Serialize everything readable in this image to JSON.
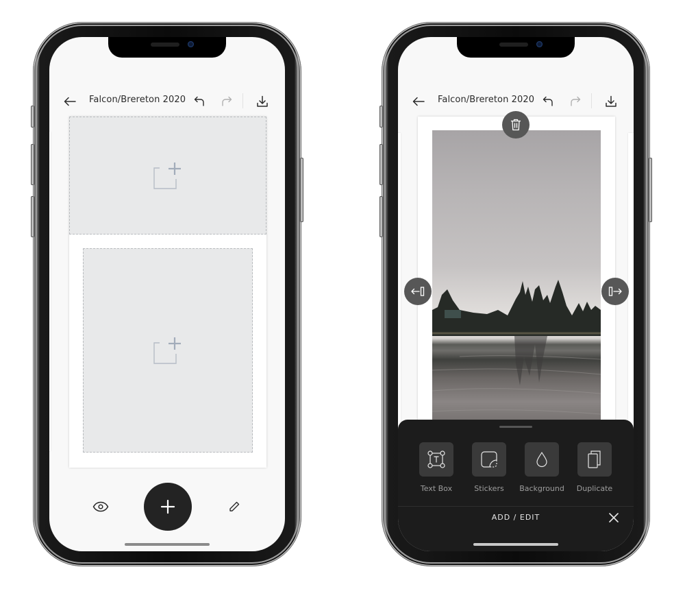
{
  "phones": [
    {
      "id": "left",
      "header": {
        "title": "Falcon/Brereton 2020",
        "back_icon": "arrow-left-icon",
        "undo_icon": "undo-icon",
        "redo_icon": "redo-icon",
        "download_icon": "download-icon"
      },
      "canvas": {
        "slots": [
          {
            "name": "top-photo-slot",
            "icon": "add-photo-icon"
          },
          {
            "name": "bottom-photo-slot",
            "icon": "add-photo-icon"
          }
        ]
      },
      "toolbar": {
        "preview_icon": "eye-icon",
        "add_icon": "plus-icon",
        "edit_icon": "pencil-icon"
      }
    },
    {
      "id": "right",
      "header": {
        "title": "Falcon/Brereton 2020",
        "back_icon": "arrow-left-icon",
        "undo_icon": "undo-icon",
        "redo_icon": "redo-icon",
        "download_icon": "download-icon"
      },
      "canvas": {
        "photo": "lake-with-pine-trees-photo",
        "controls": {
          "delete_icon": "trash-icon",
          "move_left_icon": "move-left-icon",
          "move_right_icon": "move-right-icon"
        }
      },
      "sheet": {
        "tools": [
          {
            "label": "Text Box",
            "icon": "text-box-icon"
          },
          {
            "label": "Stickers",
            "icon": "sticker-icon"
          },
          {
            "label": "Background",
            "icon": "droplet-icon"
          },
          {
            "label": "Duplicate",
            "icon": "duplicate-icon"
          }
        ],
        "footer_title": "ADD / EDIT",
        "close_icon": "close-icon"
      }
    }
  ],
  "colors": {
    "screen_bg": "#f8f8f8",
    "slot_bg": "#e8e9ea",
    "fab_bg": "#232323",
    "sheet_bg": "#1c1c1c",
    "control_bg": "#575757",
    "text_primary": "#2a2a2a"
  }
}
